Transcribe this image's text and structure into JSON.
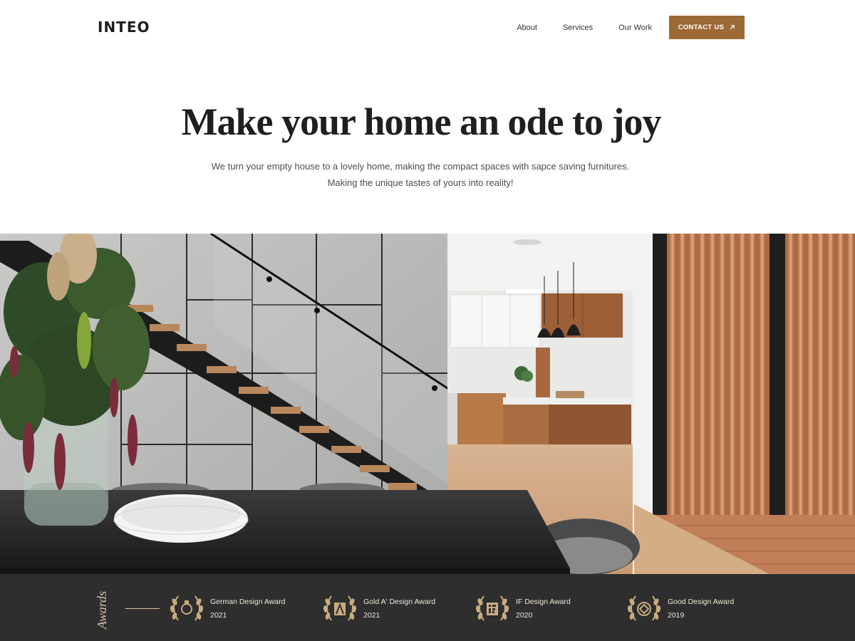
{
  "brand": {
    "logo": "INTEO"
  },
  "nav": {
    "links": [
      "About",
      "Services",
      "Our Work"
    ],
    "contact_label": "CONTACT US"
  },
  "hero": {
    "title": "Make your home an ode to joy",
    "subtitle_line1": "We turn your empty house to a lovely home, making the compact spaces with sapce saving furnitures.",
    "subtitle_line2": "Making the unique tastes of yours into reality!"
  },
  "awards": {
    "label": "Awards",
    "items": [
      {
        "name": "German Design Award",
        "year": "2021",
        "icon": "german-design-award-icon"
      },
      {
        "name": "Gold A' Design Award",
        "year": "2021",
        "icon": "a-design-award-icon"
      },
      {
        "name": "IF Design Award",
        "year": "2020",
        "icon": "if-design-award-icon"
      },
      {
        "name": "Good Design Award",
        "year": "2019",
        "icon": "good-design-award-icon"
      }
    ]
  },
  "colors": {
    "accent": "#9c6a36",
    "awards_bg": "#2e2e2e",
    "awards_gold": "#d8c4a4"
  }
}
